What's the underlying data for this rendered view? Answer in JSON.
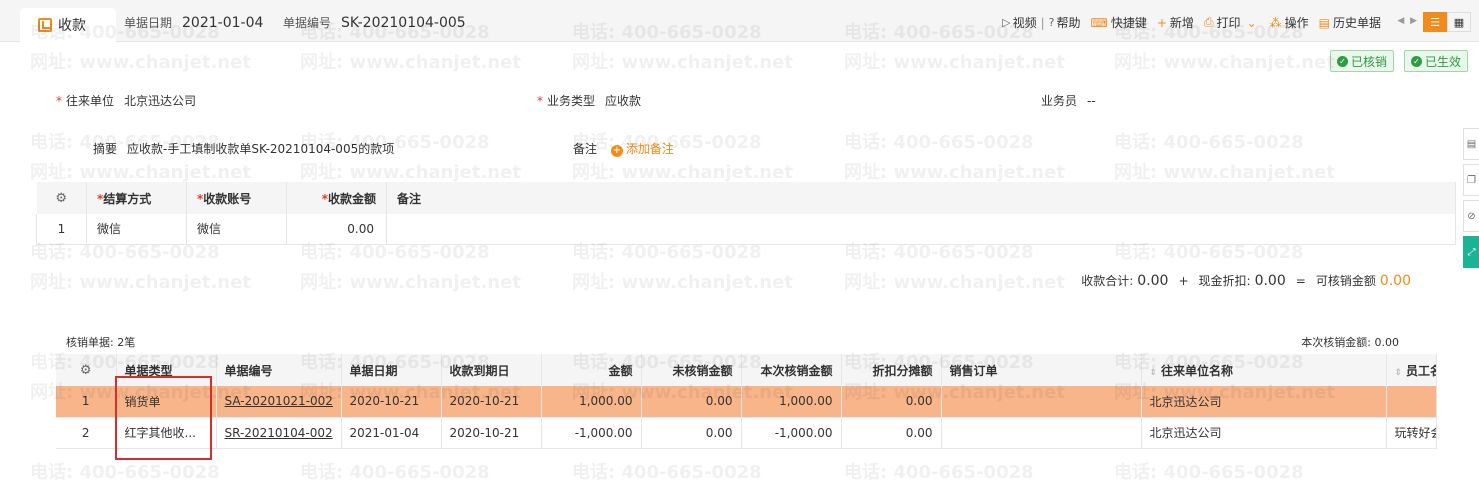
{
  "header": {
    "tab_label": "收款",
    "date_label": "单据日期",
    "date_value": "2021-01-04",
    "number_label": "单据编号",
    "number_value": "SK-20210104-005"
  },
  "toolbar": {
    "video": "视频",
    "help": "帮助",
    "shortcut": "快捷键",
    "new": "新增",
    "print": "打印",
    "operate": "操作",
    "history": "历史单据"
  },
  "badges": {
    "writtenoff": "已核销",
    "effective": "已生效"
  },
  "form": {
    "partner_label": "往来单位",
    "partner_value": "北京迅达公司",
    "biz_type_label": "业务类型",
    "biz_type_value": "应收款",
    "salesman_label": "业务员",
    "salesman_value": "--",
    "summary_label": "摘要",
    "summary_value": "应收款-手工填制收款单SK-20210104-005的款项",
    "note_label": "备注",
    "add_note": "添加备注"
  },
  "settle_table": {
    "headers": [
      "结算方式",
      "收款账号",
      "收款金额",
      "备注"
    ],
    "rows": [
      {
        "idx": "1",
        "method": "微信",
        "account": "微信",
        "amount": "0.00",
        "note": ""
      }
    ]
  },
  "totals": {
    "received_label": "收款合计:",
    "received_value": "0.00",
    "plus": "+",
    "discount_label": "现金折扣:",
    "discount_value": "0.00",
    "equals": "=",
    "writable_label": "可核销金额",
    "writable_value": "0.00"
  },
  "writeoff": {
    "count_label": "核销单据: 2笔",
    "current_label": "本次核销金额: 0.00",
    "headers": [
      "单据类型",
      "单据编号",
      "单据日期",
      "收款到期日",
      "金额",
      "未核销金额",
      "本次核销金额",
      "折扣分摊额",
      "销售订单",
      "往来单位名称",
      "员工名"
    ],
    "rows": [
      {
        "idx": "1",
        "type": "销货单",
        "number": "SA-20201021-002",
        "date": "2020-10-21",
        "due": "2020-10-21",
        "amount": "1,000.00",
        "unwritten": "0.00",
        "current": "1,000.00",
        "discount": "0.00",
        "order": "",
        "partner": "北京迅达公司",
        "employee": ""
      },
      {
        "idx": "2",
        "type": "红字其他收...",
        "number": "SR-20210104-002",
        "date": "2021-01-04",
        "due": "2020-10-21",
        "amount": "-1,000.00",
        "unwritten": "0.00",
        "current": "-1,000.00",
        "discount": "0.00",
        "order": "",
        "partner": "北京迅达公司",
        "employee": "玩转好会"
      }
    ]
  },
  "watermark": {
    "phone": "电话: 400-665-0028",
    "site": "网址: www.chanjet.net"
  },
  "colors": {
    "accent": "#f08c1b",
    "selected_row": "#f8b58a",
    "status_green": "#2e9c3f",
    "required_red": "#e53935",
    "highlight_box": "#d32f2f"
  }
}
